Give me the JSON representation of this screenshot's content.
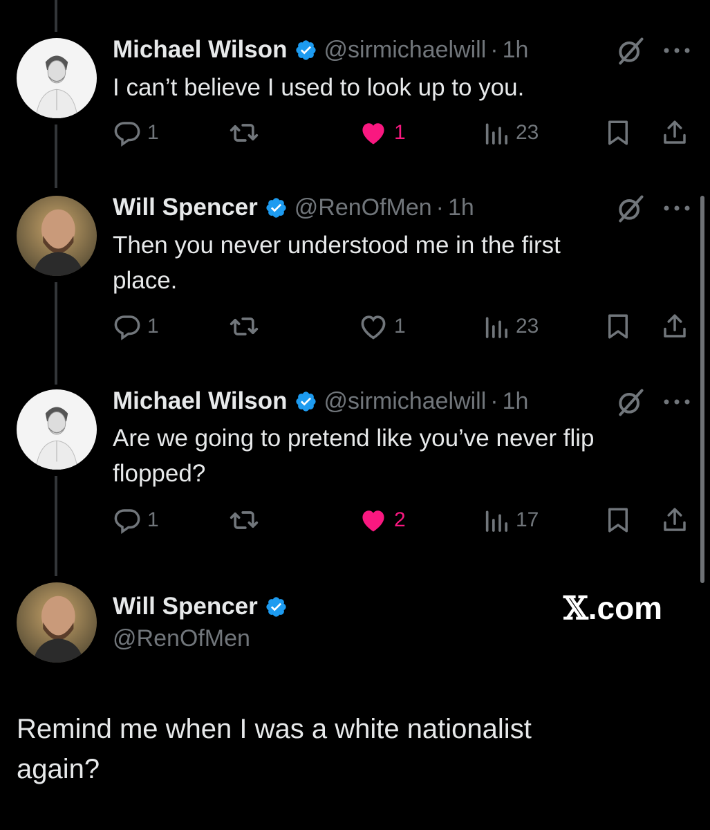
{
  "tweets": [
    {
      "name": "Michael Wilson",
      "handle": "@sirmichaelwill",
      "dot": "·",
      "time": "1h",
      "lines": [
        "I can’t believe I used to look up to you."
      ],
      "replies": "1",
      "likes": "1",
      "liked": true,
      "views": "23"
    },
    {
      "name": "Will Spencer",
      "handle": "@RenOfMen",
      "dot": "·",
      "time": "1h",
      "lines": [
        "Then you never understood me in the first",
        "place."
      ],
      "replies": "1",
      "likes": "1",
      "liked": false,
      "views": "23"
    },
    {
      "name": "Michael Wilson",
      "handle": "@sirmichaelwill",
      "dot": "·",
      "time": "1h",
      "lines": [
        "Are we going to pretend like you’ve never flip",
        "flopped?"
      ],
      "replies": "1",
      "likes": "2",
      "liked": true,
      "views": "17"
    }
  ],
  "main_tweet": {
    "name": "Will Spencer",
    "handle": "@RenOfMen",
    "lines": [
      "Remind me when I was a white nationalist",
      "again?"
    ]
  },
  "watermark": {
    "x": "𝕏",
    "rest": ".com"
  },
  "colors": {
    "background": "#000000",
    "text": "#e7e9ea",
    "muted": "#71767b",
    "like": "#f91880",
    "verified": "#1d9bf0",
    "thread_line": "#333639"
  },
  "icons": [
    "reply-icon",
    "retweet-icon",
    "like-icon",
    "views-icon",
    "bookmark-icon",
    "share-icon",
    "grok-icon",
    "more-icon",
    "verified-badge-icon"
  ]
}
